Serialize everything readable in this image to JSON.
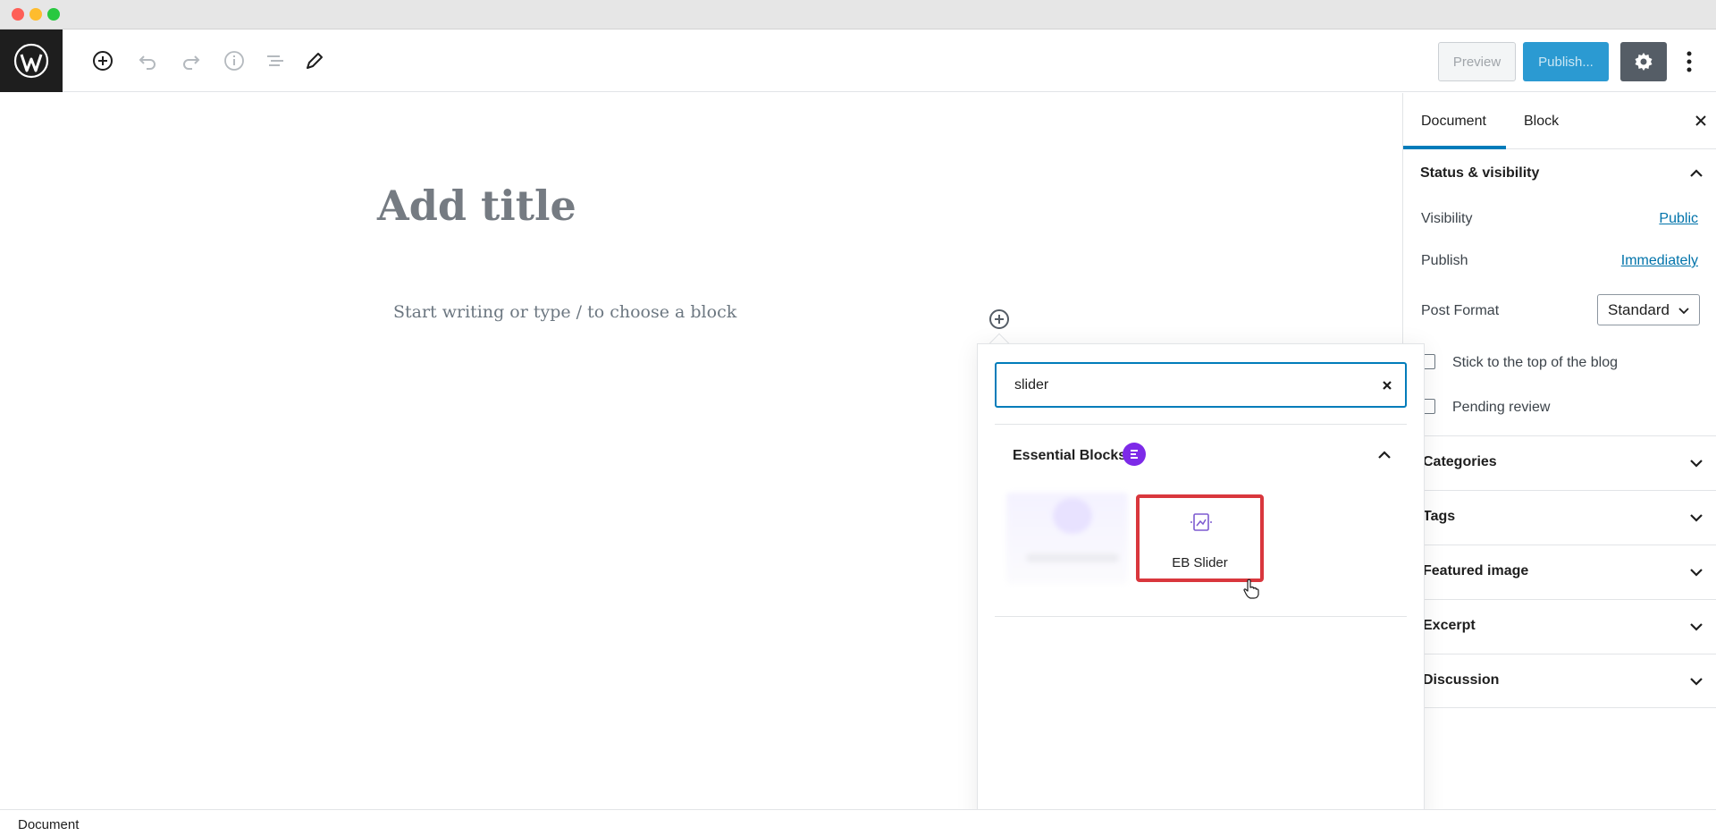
{
  "window": {
    "controls": [
      "close",
      "minimize",
      "maximize"
    ]
  },
  "header": {
    "logo": "wordpress-logo",
    "tools": [
      "add-block-icon",
      "undo-icon",
      "redo-icon",
      "info-icon",
      "outline-icon",
      "edit-icon"
    ],
    "preview_label": "Preview",
    "publish_label": "Publish...",
    "settings_icon": "gear-icon",
    "more_icon": "more-vertical-icon"
  },
  "editor": {
    "title_placeholder": "Add title",
    "paragraph_placeholder": "Start writing or type / to choose a block"
  },
  "sidebar": {
    "tabs": [
      {
        "label": "Document",
        "active": true
      },
      {
        "label": "Block",
        "active": false
      }
    ],
    "status": {
      "title": "Status & visibility",
      "visibility_label": "Visibility",
      "visibility_value": "Public",
      "publish_label": "Publish",
      "publish_value": "Immediately",
      "post_format_label": "Post Format",
      "post_format_value": "Standard",
      "stick_label": "Stick to the top of the blog",
      "pending_label": "Pending review"
    },
    "panels": [
      "Categories",
      "Tags",
      "Featured image",
      "Excerpt",
      "Discussion"
    ]
  },
  "inserter": {
    "search_value": "slider",
    "category_title": "Essential Blocks",
    "block_label": "EB Slider"
  },
  "footer": {
    "breadcrumb": "Document"
  },
  "colors": {
    "accent": "#007cba",
    "publish": "#2b9ad2",
    "highlight": "#d9373d",
    "badge": "#7d2ae8"
  }
}
